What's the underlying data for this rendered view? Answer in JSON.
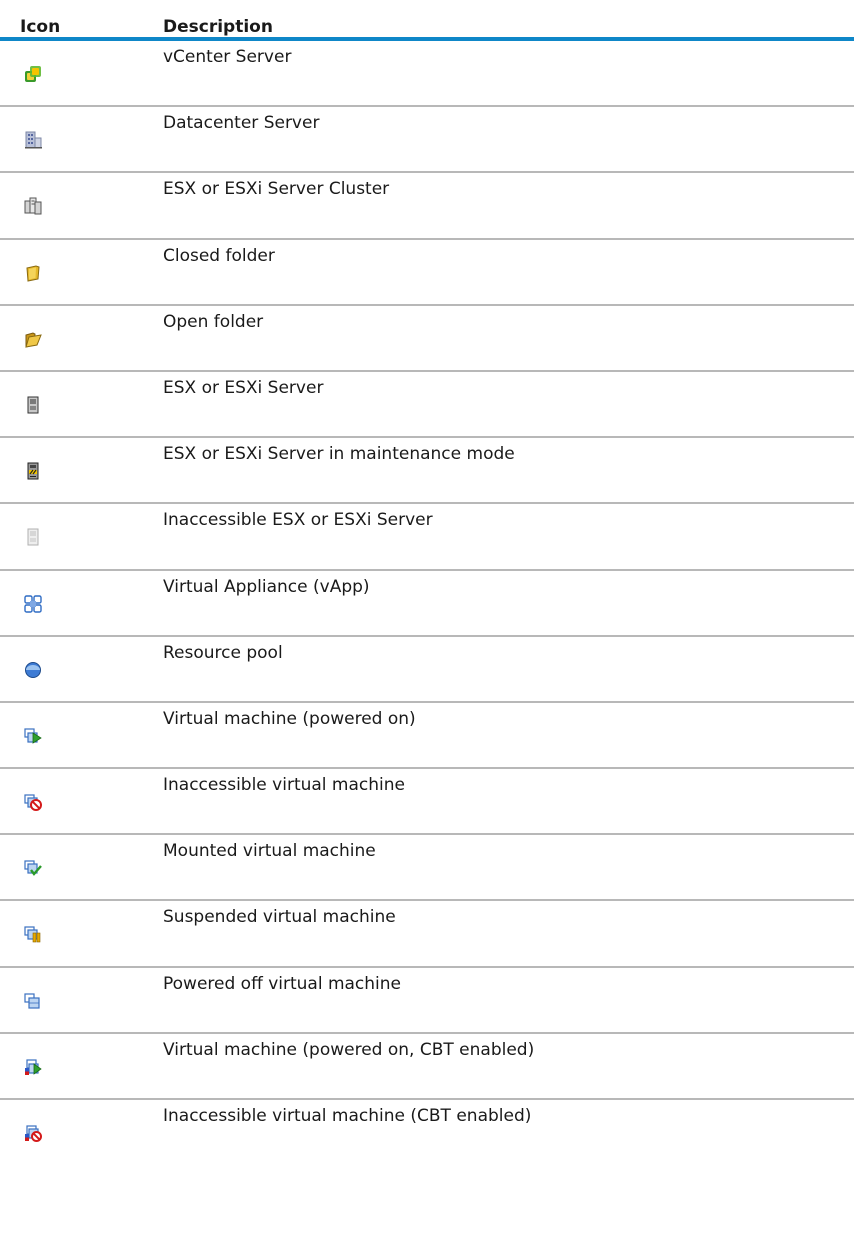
{
  "table": {
    "headers": {
      "icon": "Icon",
      "description": "Description"
    },
    "rows": [
      {
        "icon": "vcenter-server-icon",
        "description": "vCenter Server"
      },
      {
        "icon": "datacenter-server-icon",
        "description": "Datacenter Server"
      },
      {
        "icon": "server-cluster-icon",
        "description": "ESX or ESXi Server Cluster"
      },
      {
        "icon": "closed-folder-icon",
        "description": "Closed folder"
      },
      {
        "icon": "open-folder-icon",
        "description": "Open folder"
      },
      {
        "icon": "esx-server-icon",
        "description": "ESX or ESXi Server"
      },
      {
        "icon": "esx-server-maintenance-icon",
        "description": "ESX or ESXi Server in maintenance mode"
      },
      {
        "icon": "inaccessible-esx-server-icon",
        "description": "Inaccessible ESX or ESXi Server"
      },
      {
        "icon": "virtual-appliance-icon",
        "description": "Virtual Appliance (vApp)"
      },
      {
        "icon": "resource-pool-icon",
        "description": "Resource pool"
      },
      {
        "icon": "vm-powered-on-icon",
        "description": "Virtual machine (powered on)"
      },
      {
        "icon": "inaccessible-vm-icon",
        "description": "Inaccessible virtual machine"
      },
      {
        "icon": "mounted-vm-icon",
        "description": "Mounted virtual machine"
      },
      {
        "icon": "suspended-vm-icon",
        "description": "Suspended virtual machine"
      },
      {
        "icon": "powered-off-vm-icon",
        "description": "Powered off virtual machine"
      },
      {
        "icon": "vm-powered-on-cbt-icon",
        "description": "Virtual machine (powered on, CBT enabled)"
      },
      {
        "icon": "inaccessible-vm-cbt-icon",
        "description": "Inaccessible virtual machine (CBT enabled)"
      }
    ]
  },
  "colors": {
    "header_rule": "#0f87c8",
    "row_rule": "#b8b8b8"
  }
}
